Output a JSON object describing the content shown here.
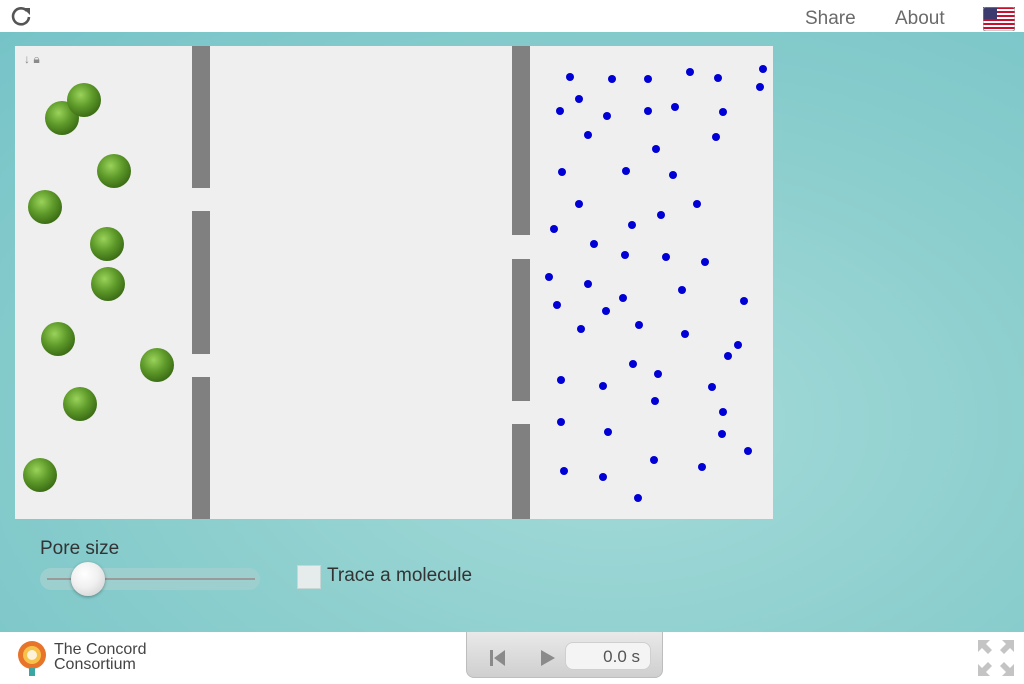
{
  "header": {
    "share_label": "Share",
    "about_label": "About"
  },
  "controls": {
    "pore_size_label": "Pore size",
    "pore_size_value": 0.2,
    "trace_label": "Trace a molecule",
    "trace_checked": false
  },
  "footer": {
    "logo_line1": "The Concord",
    "logo_line2": "Consortium",
    "time_display": "0.0 s"
  },
  "colors": {
    "large_molecule": "#5e9a2a",
    "small_molecule": "#0000d6",
    "membrane": "#808080",
    "sim_background": "#efefef"
  },
  "icons": [
    "reload-icon",
    "us-flag-icon",
    "pin-icon",
    "lock-icon",
    "concord-logo-icon",
    "reset-icon",
    "play-icon",
    "fullscreen-icon"
  ]
}
